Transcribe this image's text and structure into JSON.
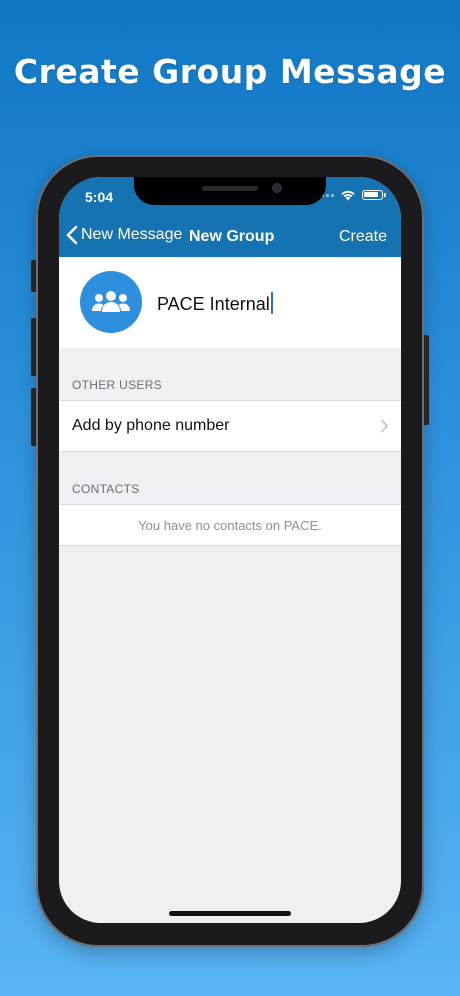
{
  "headline": "Create Group Message",
  "status_bar": {
    "time": "5:04"
  },
  "nav": {
    "back_label": "New Message",
    "title": "New Group",
    "action_label": "Create"
  },
  "group": {
    "name_value": "PACE Internal",
    "avatar_icon": "group-people-icon"
  },
  "sections": {
    "other_users": {
      "header": "OTHER USERS",
      "row_label": "Add by phone number"
    },
    "contacts": {
      "header": "CONTACTS",
      "empty_text": "You have no contacts on PACE."
    }
  },
  "colors": {
    "nav_bar": "#1673b1",
    "avatar": "#2f8fdf",
    "background_top": "#1077c4",
    "background_bottom": "#58b4f4"
  }
}
